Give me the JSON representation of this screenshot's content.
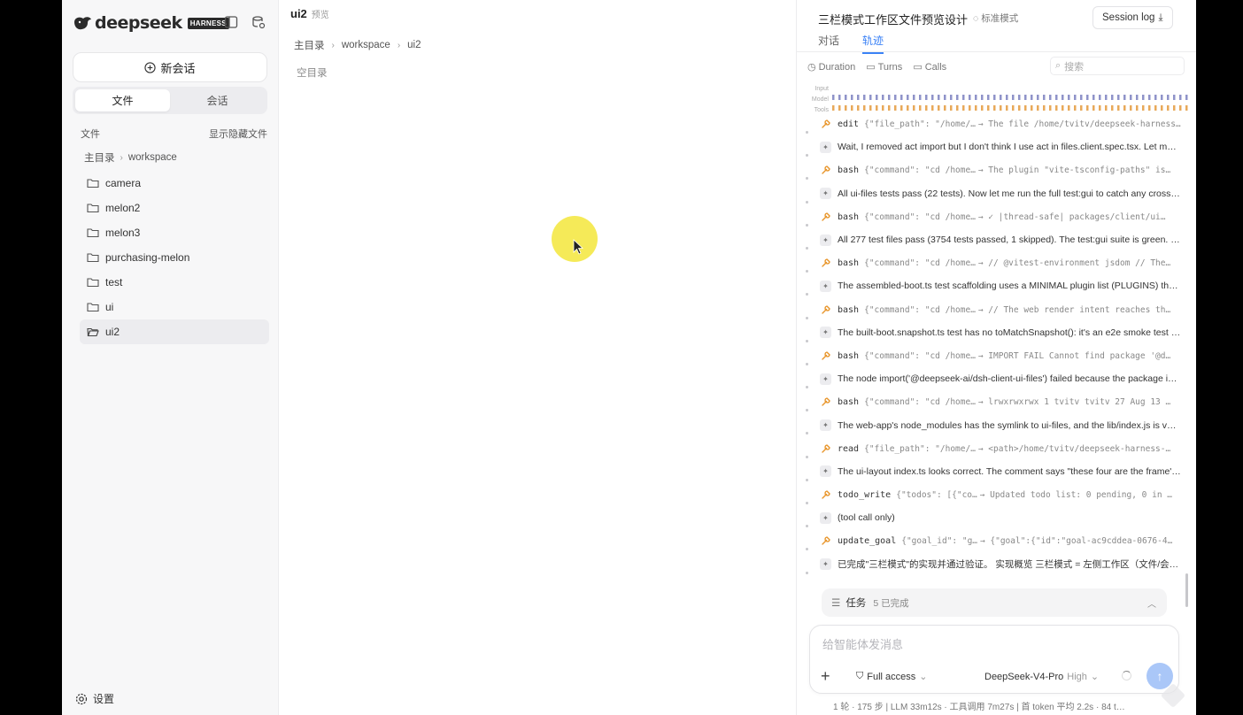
{
  "sidebar": {
    "brand_name": "deepseek",
    "brand_tag": "HARNESS",
    "new_chat_label": "新会话",
    "tabs": [
      {
        "label": "文件",
        "active": true
      },
      {
        "label": "会话",
        "active": false
      }
    ],
    "files_header": "文件",
    "show_hidden_label": "显示隐藏文件",
    "breadcrumb": [
      "主目录",
      "workspace"
    ],
    "folders": [
      {
        "name": "camera",
        "selected": false
      },
      {
        "name": "melon2",
        "selected": false
      },
      {
        "name": "melon3",
        "selected": false
      },
      {
        "name": "purchasing-melon",
        "selected": false
      },
      {
        "name": "test",
        "selected": false
      },
      {
        "name": "ui",
        "selected": false
      },
      {
        "name": "ui2",
        "selected": true
      }
    ],
    "settings_label": "设置"
  },
  "middle": {
    "title": "ui2",
    "subtitle": "预览",
    "breadcrumb": [
      "主目录",
      "workspace",
      "ui2"
    ],
    "empty_text": "空目录"
  },
  "right": {
    "title": "三栏模式工作区文件预览设计",
    "mode_label": "标准模式",
    "session_log_label": "Session log",
    "tabs": [
      {
        "label": "对话",
        "active": false
      },
      {
        "label": "轨迹",
        "active": true
      }
    ],
    "filters": {
      "duration": "Duration",
      "turns": "Turns",
      "calls": "Calls"
    },
    "search_placeholder": "搜索",
    "timeline_labels": [
      "Input",
      "Model",
      "Tools"
    ],
    "trace": [
      {
        "kind": "tool",
        "name": "edit",
        "args": "{\"file_path\": \"/home/…",
        "result": "→ The file /home/tvitv/deepseek-harness…"
      },
      {
        "kind": "msg",
        "text": "Wait, I removed act import but I don't think I use act in files.client.spec.tsx. Let me…"
      },
      {
        "kind": "tool",
        "name": "bash",
        "args": "{\"command\": \"cd /home…",
        "result": "→ The plugin \"vite-tsconfig-paths\" is…"
      },
      {
        "kind": "msg",
        "text": "All ui-files tests pass (22 tests). Now let me run the full test:gui to catch any cross-…"
      },
      {
        "kind": "tool",
        "name": "bash",
        "args": "{\"command\": \"cd /home…",
        "result": "→ ✓ |thread-safe| packages/client/ui…"
      },
      {
        "kind": "msg",
        "text": "All 277 test files pass (3754 tests passed, 1 skipped). The test:gui suite is green. N…"
      },
      {
        "kind": "tool",
        "name": "bash",
        "args": "{\"command\": \"cd /home…",
        "result": "→ // @vitest-environment jsdom // The…"
      },
      {
        "kind": "msg",
        "text": "The assembled-boot.ts test scaffolding uses a MINIMAL plugin list (PLUGINS) that…"
      },
      {
        "kind": "tool",
        "name": "bash",
        "args": "{\"command\": \"cd /home…",
        "result": "→ // The web render intent reaches th…"
      },
      {
        "kind": "msg",
        "text": "The built-boot.snapshot.ts test has no toMatchSnapshot(): it's an e2e smoke test …"
      },
      {
        "kind": "tool",
        "name": "bash",
        "args": "{\"command\": \"cd /home…",
        "result": "→ IMPORT FAIL Cannot find package '@d…"
      },
      {
        "kind": "msg",
        "text": "The node import('@deepseek-ai/dsh-client-ui-files') failed because the package is…"
      },
      {
        "kind": "tool",
        "name": "bash",
        "args": "{\"command\": \"cd /home…",
        "result": "→ lrwxrwxrwx 1 tvitv tvitv 27 Aug 13 …"
      },
      {
        "kind": "msg",
        "text": "The web-app's node_modules has the symlink to ui-files, and the lib/index.js is val…"
      },
      {
        "kind": "tool",
        "name": "read",
        "args": "{\"file_path\": \"/home/…",
        "result": "→ <path>/home/tvitv/deepseek-harness-…"
      },
      {
        "kind": "msg",
        "text": "The ui-layout index.ts looks correct. The comment says \"these four are the frame'…"
      },
      {
        "kind": "tool",
        "name": "todo_write",
        "args": "{\"todos\": [{\"co…",
        "result": "→ Updated todo list: 0 pending, 0 in …"
      },
      {
        "kind": "msg",
        "text": "(tool call only)"
      },
      {
        "kind": "tool",
        "name": "update_goal",
        "args": "{\"goal_id\": \"g…",
        "result": "→ {\"goal\":{\"id\":\"goal-ac9cddea-0676-4…"
      },
      {
        "kind": "msg",
        "text": "已完成\"三栏模式\"的实现并通过验证。 实现概览 三栏模式 = 左侧工作区（文件/会…"
      }
    ],
    "task_label": "任务",
    "task_count": "5 已完成",
    "composer_placeholder": "给智能体发消息",
    "access_label": "Full access",
    "model_label": "DeepSeek-V4-Pro",
    "model_level": "High",
    "status_text": "1 轮 · 175 步  |  LLM 33m12s · 工具调用 7m27s  |  首 token 平均 2.2s · 84 t…"
  },
  "colors": {
    "accent": "#3b82f6",
    "tool_icon": "#e8952a",
    "send_button": "#aac7f8"
  }
}
